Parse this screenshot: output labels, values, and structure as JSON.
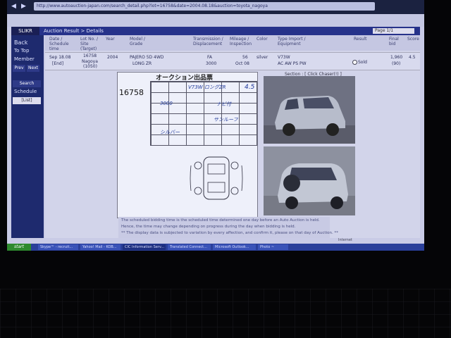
{
  "browser": {
    "address": "http://www.autoauction-japan.com/search_detail.php?lot=16758&date=2004.08.18&auction=toyota_nagoya",
    "back_glyph": "◀",
    "forward_glyph": "▶"
  },
  "blueband": {
    "tab_label": "SLIKR",
    "breadcrumb": "Auction Result > Details",
    "page_select": "Page 1/1"
  },
  "sidebar": {
    "back": "Back",
    "to_top": "To Top",
    "member": "Member",
    "prev_label": "Prev",
    "next_label": "Next",
    "search": "Search",
    "schedule": "Schedule",
    "list_label": "[List]"
  },
  "table": {
    "headers": {
      "date": "Date / Schedule time",
      "lot": "Lot No. / Site (Target)",
      "year": "Year",
      "model": "Model / Grade",
      "trans": "Transmission / Displacement",
      "mileage": "Mileage / Inspection",
      "color": "Color",
      "type": "Type Import / Equipment",
      "result": "Result",
      "price": "Final bid",
      "score": "Score"
    },
    "row": {
      "date": "Sep 18.08",
      "date2": "[End]",
      "lot": "16758",
      "site": "Nagoya",
      "site2": "(1050)",
      "year": "2004",
      "model": "PAJERO 5D 4WD",
      "grade": "LONG ZR",
      "trans": "FA",
      "disp": "3000",
      "mileage": "56",
      "inspection": "Oct 08",
      "color": "silver",
      "type": "V73W",
      "equipment": "AC AW PS PW",
      "result": "Sold",
      "price": "1,960",
      "price2": "(90)",
      "score": "4.5"
    }
  },
  "section": {
    "label": "Section : [ Click Chaser(!) ]"
  },
  "sheet": {
    "title": "オークション出品票",
    "lot_number": "16758",
    "handwriting": [
      "V73W ロングZR",
      "4.5",
      "ナビ付",
      "サンルーフ",
      "3000",
      "シルバー"
    ]
  },
  "notice": {
    "line1": "The scheduled bidding time is the scheduled time determined one day before an Auto Auction is held.",
    "line2": "Hence, the time may change depending on progress during the day when bidding is held.",
    "line3": "** The display data is subjected to variation by every affection, and confirm it, please on that day of Auction. **"
  },
  "taskbar": {
    "start": "start",
    "tasks": [
      "Skype™ - recruit...",
      "Yahoo! Mail - KOB...",
      "CIC Information Serv...",
      "Translated Connect...",
      "Microsoft Outlook...",
      "Photo ~"
    ]
  },
  "statusbar": {
    "zone": "Internet"
  }
}
